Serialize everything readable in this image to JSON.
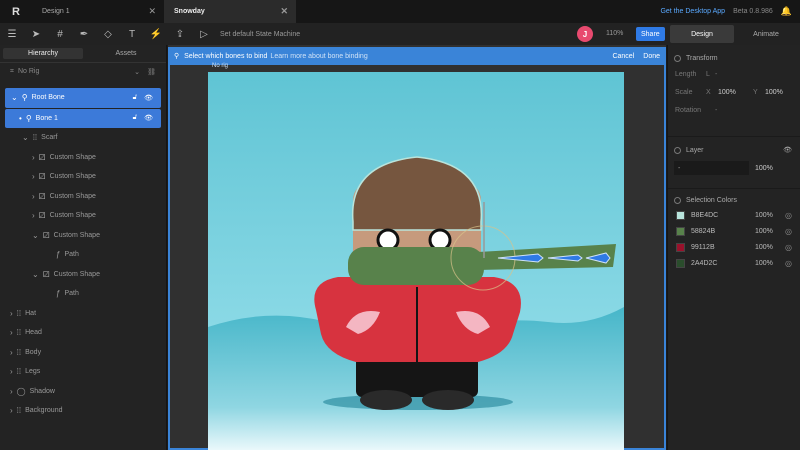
{
  "tabs": [
    {
      "label": "Design 1"
    },
    {
      "label": "Snowday"
    }
  ],
  "top_right": {
    "get_app": "Get the Desktop App",
    "beta": "Beta 0.8.986"
  },
  "toolbar": {
    "state_machine": "Set default State Machine",
    "avatar": "J",
    "zoom": "110%",
    "share": "Share"
  },
  "right_tabs": {
    "design": "Design",
    "animate": "Animate"
  },
  "left_tabs": {
    "hierarchy": "Hierarchy",
    "assets": "Assets"
  },
  "no_rig": "No Rig",
  "tree": [
    {
      "label": "Root Bone"
    },
    {
      "label": "Bone 1"
    },
    {
      "label": "Scarf"
    },
    {
      "label": "Custom Shape"
    },
    {
      "label": "Custom Shape"
    },
    {
      "label": "Custom Shape"
    },
    {
      "label": "Custom Shape"
    },
    {
      "label": "Custom Shape"
    },
    {
      "label": "Path"
    },
    {
      "label": "Custom Shape"
    },
    {
      "label": "Path"
    },
    {
      "label": "Hat"
    },
    {
      "label": "Head"
    },
    {
      "label": "Body"
    },
    {
      "label": "Legs"
    },
    {
      "label": "Shadow"
    },
    {
      "label": "Background"
    }
  ],
  "bind_bar": {
    "text": "Select which bones to bind",
    "link": "Learn more about bone binding",
    "cancel": "Cancel",
    "done": "Done"
  },
  "artboard_label": "No rig",
  "transform": {
    "title": "Transform",
    "length_label": "Length",
    "length_unit": "L",
    "length_value": "-",
    "scale_label": "Scale",
    "scale_x_label": "X",
    "scale_x": "100%",
    "scale_y_label": "Y",
    "scale_y": "100%",
    "rotation_label": "Rotation",
    "rotation_value": "-"
  },
  "layer": {
    "title": "Layer",
    "blend": "-",
    "opacity": "100%"
  },
  "selection_colors": {
    "title": "Selection Colors",
    "items": [
      {
        "hex": "B8E4DC",
        "pct": "100%",
        "color": "#B8E4DC"
      },
      {
        "hex": "58824B",
        "pct": "100%",
        "color": "#58824B"
      },
      {
        "hex": "99112B",
        "pct": "100%",
        "color": "#99112B"
      },
      {
        "hex": "2A4D2C",
        "pct": "100%",
        "color": "#2A4D2C"
      }
    ]
  }
}
